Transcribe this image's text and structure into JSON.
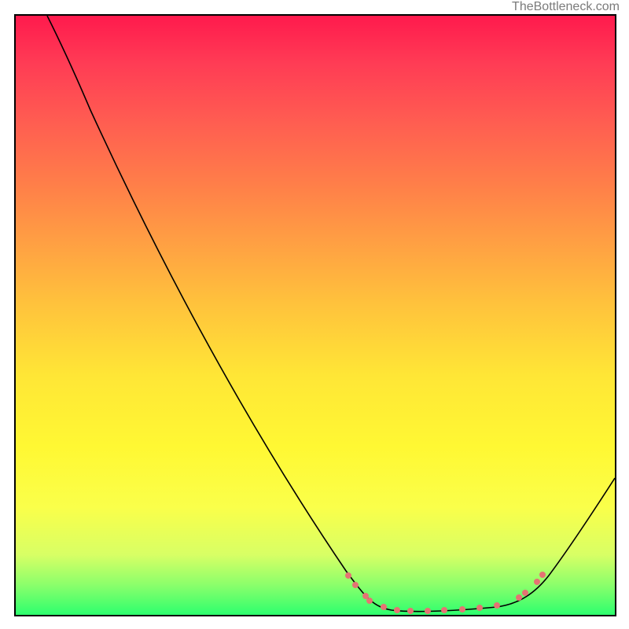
{
  "watermark": "TheBottleneck.com",
  "chart_data": {
    "type": "line",
    "title": "",
    "xlabel": "",
    "ylabel": "",
    "xlim": [
      0,
      100
    ],
    "ylim": [
      0,
      100
    ],
    "grid": false,
    "legend": false,
    "background_gradient": {
      "direction": "vertical_top_to_bottom",
      "stops": [
        {
          "pos": 0.0,
          "color": "#ff1a4d"
        },
        {
          "pos": 0.5,
          "color": "#ffc23c"
        },
        {
          "pos": 0.8,
          "color": "#faff4a"
        },
        {
          "pos": 1.0,
          "color": "#2dff6e"
        }
      ],
      "meaning_low": "bad",
      "meaning_high": "optimal"
    },
    "series": [
      {
        "name": "bottleneck-curve",
        "x": [
          5,
          12,
          25,
          40,
          55,
          60,
          65,
          72,
          78,
          83,
          88,
          93,
          100
        ],
        "y": [
          100,
          85,
          62,
          38,
          10,
          4,
          1,
          0.5,
          0.5,
          1,
          3,
          7,
          23
        ],
        "stroke": "#000000"
      }
    ],
    "highlight_points": {
      "name": "optimal-zone",
      "color": "#e57373",
      "x": [
        55,
        57,
        59,
        60,
        62,
        65,
        67,
        70,
        73,
        76,
        79,
        81,
        84,
        85,
        87,
        88
      ],
      "y": [
        7,
        5,
        3.5,
        3,
        1.5,
        1,
        0.8,
        0.6,
        0.7,
        0.8,
        1,
        1.3,
        2.5,
        3,
        5,
        6
      ]
    }
  }
}
